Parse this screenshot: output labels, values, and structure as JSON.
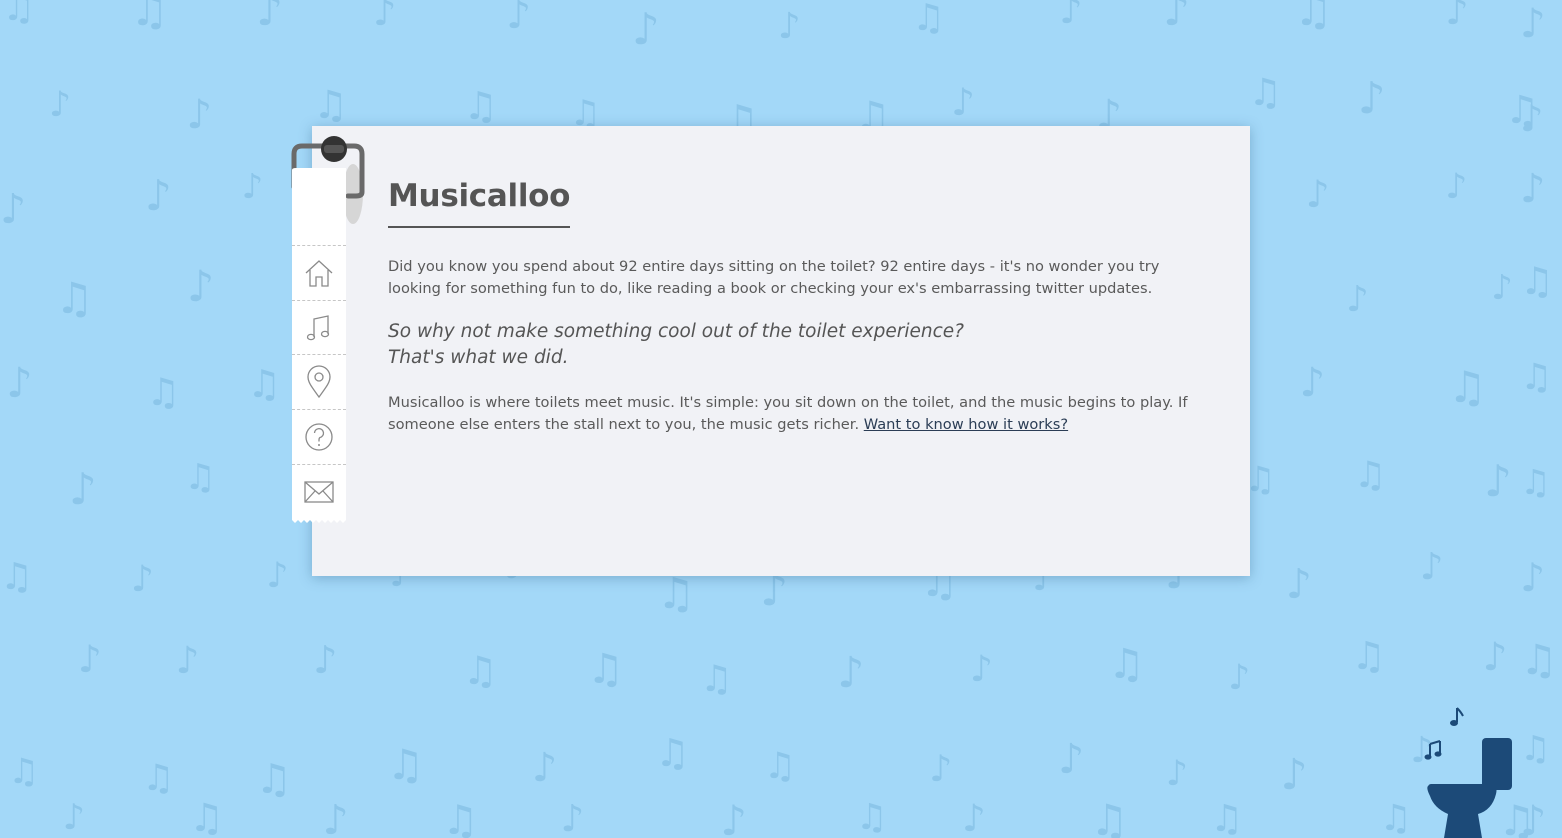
{
  "page": {
    "background_color": "#a3d8f8",
    "note_color": "#8cc6ea",
    "card_color": "#f1f2f6",
    "text_color": "#5a5a5a",
    "toilet_color": "#1c4a78"
  },
  "title": "Musicalloo",
  "intro": "Did you know you spend about 92 entire days sitting on the toilet? 92 entire days - it's no wonder you try looking for something fun to do, like reading a book or checking your ex's embarrassing twitter updates.",
  "quote": {
    "line1": "So why not make something cool out of the toilet experience?",
    "line2": "That's what we did."
  },
  "description": "Musicalloo is where toilets meet music. It's simple: you sit down on the toilet, and the music begins to play. If someone else enters the stall next to you, the music gets richer.",
  "link_text": "Want to know how it works?",
  "nav": {
    "items": [
      {
        "id": "home",
        "icon": "home-icon"
      },
      {
        "id": "music",
        "icon": "music-note-icon"
      },
      {
        "id": "location",
        "icon": "map-pin-icon"
      },
      {
        "id": "help",
        "icon": "question-icon"
      },
      {
        "id": "contact",
        "icon": "envelope-icon"
      }
    ]
  }
}
